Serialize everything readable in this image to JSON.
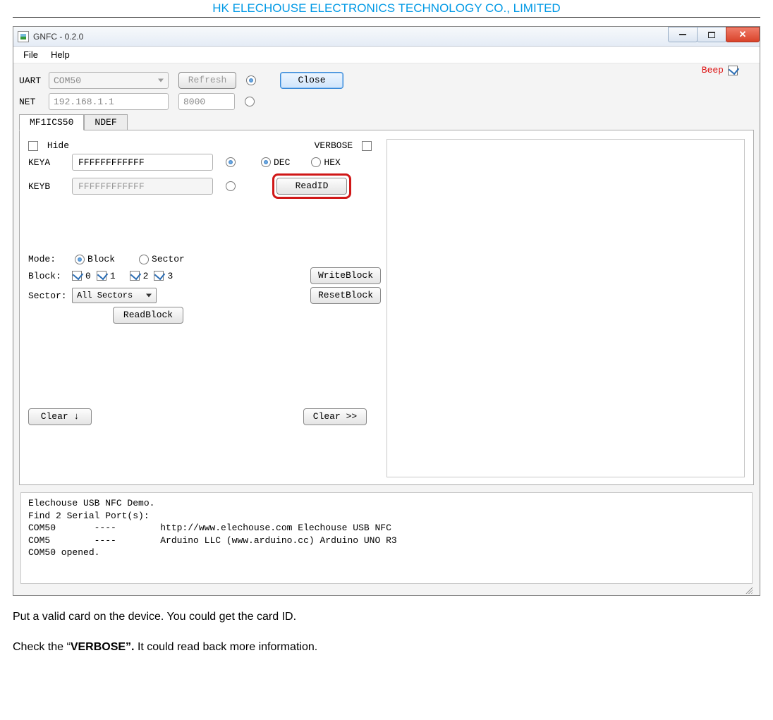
{
  "doc_header": "HK ELECHOUSE ELECTRONICS TECHNOLOGY CO., LIMITED",
  "window": {
    "title": "GNFC - 0.2.0",
    "menus": {
      "file": "File",
      "help": "Help"
    }
  },
  "conn": {
    "uart_label": "UART",
    "uart_port": "COM50",
    "refresh": "Refresh",
    "close": "Close",
    "beep_label": "Beep",
    "net_label": "NET",
    "net_ip": "192.168.1.1",
    "net_port": "8000"
  },
  "tabs": {
    "mf": "MF1ICS50",
    "ndef": "NDEF"
  },
  "panel": {
    "hide": "Hide",
    "verbose": "VERBOSE",
    "keya_label": "KEYA",
    "keya_value": "FFFFFFFFFFFF",
    "keyb_label": "KEYB",
    "keyb_value": "FFFFFFFFFFFF",
    "dec": "DEC",
    "hex": "HEX",
    "read_id": "ReadID",
    "mode_label": "Mode:",
    "mode_block": "Block",
    "mode_sector": "Sector",
    "block_label": "Block:",
    "b0": "0",
    "b1": "1",
    "b2": "2",
    "b3": "3",
    "sector_label": "Sector:",
    "sector_value": "All Sectors",
    "read_block": "ReadBlock",
    "write_block": "WriteBlock",
    "reset_block": "ResetBlock",
    "clear_down": "Clear ↓",
    "clear_right": "Clear >>"
  },
  "log": "Elechouse USB NFC Demo.\nFind 2 Serial Port(s):\nCOM50       ----        http://www.elechouse.com Elechouse USB NFC\nCOM5        ----        Arduino LLC (www.arduino.cc) Arduino UNO R3\nCOM50 opened.",
  "doc_text": {
    "p1": "Put a valid card on the device. You could get the card ID.",
    "p2a": "Check the “",
    "p2b": "VERBOSE”.",
    "p2c": " It could read back more information."
  }
}
